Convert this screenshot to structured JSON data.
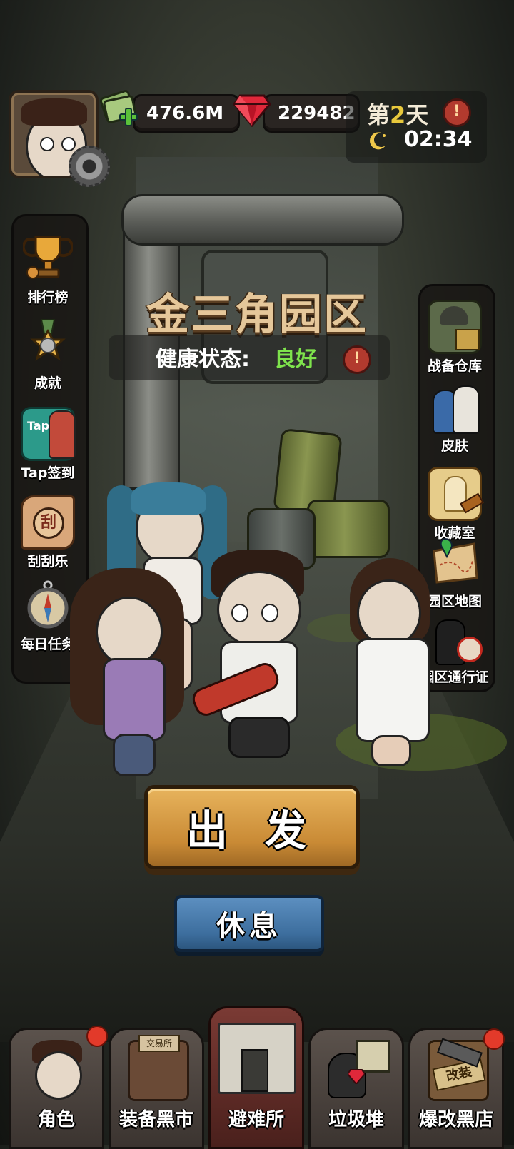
{
  "resources": {
    "cash": "476.6M",
    "gems": "229482"
  },
  "day": {
    "prefix": "第",
    "number": "2",
    "suffix": "天",
    "time": "02:34"
  },
  "alert_symbol": "!",
  "location": {
    "title": "金三角园区",
    "health_label": "健康状态:",
    "health_value": "良好"
  },
  "left_menu": [
    {
      "label": "排行榜",
      "icon": "trophy-icon"
    },
    {
      "label": "成就",
      "icon": "medal-icon"
    },
    {
      "label": "Tap签到",
      "icon": "tap-checkin-icon"
    },
    {
      "label": "刮刮乐",
      "icon": "scratch-card-icon"
    },
    {
      "label": "每日任务",
      "icon": "compass-icon"
    }
  ],
  "scratch_badge": "刮",
  "tap_badge": "Tap",
  "right_menu": [
    {
      "label": "战备仓库",
      "icon": "armory-icon"
    },
    {
      "label": "皮肤",
      "icon": "skin-icon"
    },
    {
      "label": "收藏室",
      "icon": "collection-icon"
    },
    {
      "label": "园区地图",
      "icon": "map-icon"
    },
    {
      "label": "园区通行证",
      "icon": "pass-icon"
    }
  ],
  "actions": {
    "depart": "出 发",
    "rest": "休息"
  },
  "bottom_nav": [
    {
      "label": "角色",
      "icon": "character-icon",
      "badge": true
    },
    {
      "label": "装备黑市",
      "icon": "black-market-icon",
      "badge": false,
      "sign": "交易所"
    },
    {
      "label": "避难所",
      "icon": "shelter-icon",
      "badge": false,
      "active": true
    },
    {
      "label": "垃圾堆",
      "icon": "junk-pile-icon",
      "badge": false
    },
    {
      "label": "爆改黑店",
      "icon": "mod-shop-icon",
      "badge": true,
      "sign": "改装"
    }
  ],
  "colors": {
    "day_number": "#e7c83c",
    "health_good": "#7ee34c",
    "depart_button": "#d99a42",
    "rest_button": "#4a7bab",
    "active_nav": "#6a302a"
  }
}
